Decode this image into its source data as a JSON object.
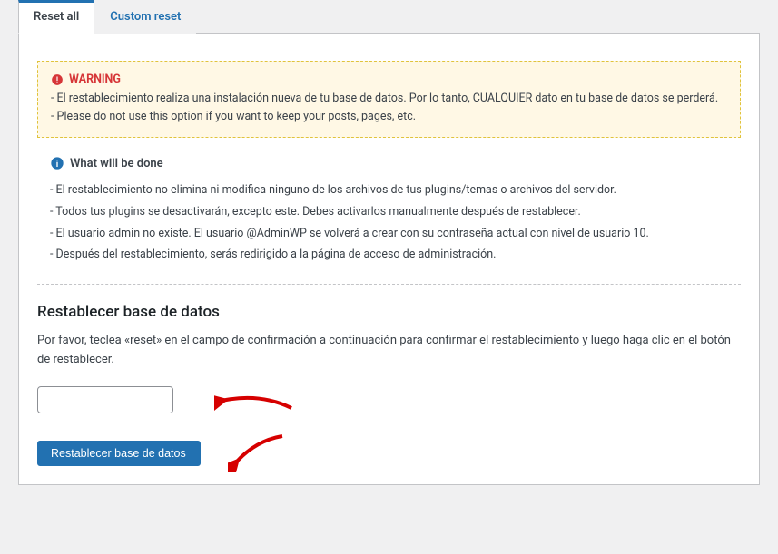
{
  "tabs": {
    "reset_all": "Reset all",
    "custom_reset": "Custom reset"
  },
  "warning": {
    "title": "WARNING",
    "line1": "- El restablecimiento realiza una instalación nueva de tu base de datos. Por lo tanto, CUALQUIER dato en tu base de datos se perderá.",
    "line2": "- Please do not use this option if you want to keep your posts, pages, etc."
  },
  "info": {
    "title": "What will be done",
    "items": [
      "- El restablecimiento no elimina ni modifica ninguno de los archivos de tus plugins/temas o archivos del servidor.",
      "- Todos tus plugins se desactivarán, excepto este. Debes activarlos manualmente después de restablecer.",
      "- El usuario admin no existe. El usuario @AdminWP se volverá a crear con su contraseña actual con nivel de usuario 10.",
      "- Después del restablecimiento, serás redirigido a la página de acceso de administración."
    ]
  },
  "reset_section": {
    "heading": "Restablecer base de datos",
    "instruction": "Por favor, teclea «reset» en el campo de confirmación a continuación para confirmar el restablecimiento y luego haga clic en el botón de restablecer.",
    "input_value": "",
    "button_label": "Restablecer base de datos"
  }
}
